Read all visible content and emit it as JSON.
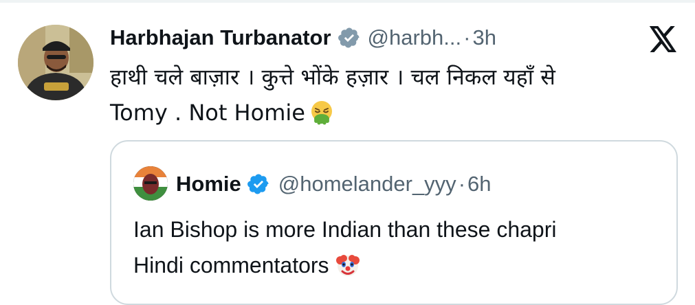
{
  "tweet": {
    "author_name": "Harbhajan Turbanator",
    "handle": "@harbh...",
    "separator": "·",
    "time": "3h",
    "text_line1": "हाथी चले बाज़ार । कुत्ते भोंके हज़ार । चल निकल यहाँ से",
    "text_line2": "Tomy . Not Homie",
    "emoji": "nauseated-face-icon",
    "menu_icon": "x-logo-icon"
  },
  "quoted_tweet": {
    "author_name": "Homie",
    "handle": "@homelander_yyy",
    "separator": "·",
    "time": "6h",
    "text_line1": "Ian Bishop is more Indian than these chapri",
    "text_line2": "Hindi commentators",
    "emoji": "clown-face-icon"
  },
  "colors": {
    "verified": "#1d9bf0",
    "secondary_text": "#536471",
    "border": "#cfd9de"
  }
}
